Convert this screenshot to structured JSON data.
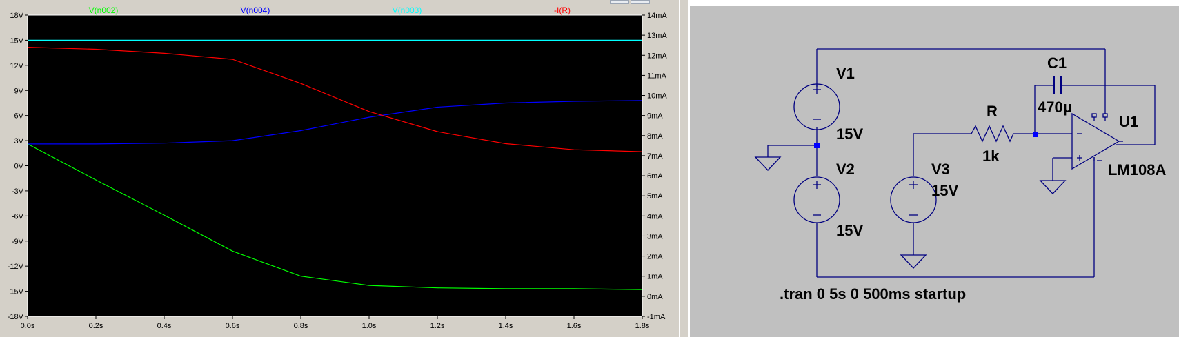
{
  "plot": {
    "traces": [
      {
        "label": "V(n002)",
        "color": "#00ff00",
        "axis": "left",
        "x": [
          0,
          0.2,
          0.4,
          0.6,
          0.8,
          1.0,
          1.2,
          1.4,
          1.6,
          1.8
        ],
        "y": [
          2.6,
          -1.7,
          -5.9,
          -10.2,
          -13.2,
          -14.3,
          -14.6,
          -14.7,
          -14.7,
          -14.8
        ]
      },
      {
        "label": "V(n004)",
        "color": "#0000ff",
        "axis": "left",
        "x": [
          0,
          0.2,
          0.4,
          0.6,
          0.8,
          1.0,
          1.2,
          1.4,
          1.6,
          1.8
        ],
        "y": [
          2.6,
          2.6,
          2.7,
          3.0,
          4.2,
          5.8,
          7.0,
          7.5,
          7.7,
          7.8
        ]
      },
      {
        "label": "V(n003)",
        "color": "#00ffff",
        "axis": "left",
        "x": [
          0,
          1.8
        ],
        "y": [
          15.0,
          15.0
        ]
      },
      {
        "label": "-I(R)",
        "color": "#ff0000",
        "axis": "right",
        "x": [
          0,
          0.2,
          0.4,
          0.6,
          0.8,
          1.0,
          1.2,
          1.4,
          1.6,
          1.8
        ],
        "y": [
          12.4,
          12.3,
          12.1,
          11.8,
          10.6,
          9.2,
          8.2,
          7.6,
          7.3,
          7.2
        ]
      }
    ],
    "left_axis": {
      "ticks": [
        "18V",
        "15V",
        "12V",
        "9V",
        "6V",
        "3V",
        "0V",
        "-3V",
        "-6V",
        "-9V",
        "-12V",
        "-15V",
        "-18V"
      ],
      "ylim": [
        -18,
        18
      ]
    },
    "right_axis": {
      "ticks": [
        "14mA",
        "13mA",
        "12mA",
        "11mA",
        "10mA",
        "9mA",
        "8mA",
        "7mA",
        "6mA",
        "5mA",
        "4mA",
        "3mA",
        "2mA",
        "1mA",
        "0mA",
        "-1mA"
      ],
      "ylim": [
        -1,
        14
      ]
    },
    "x_axis": {
      "ticks": [
        "0.0s",
        "0.2s",
        "0.4s",
        "0.6s",
        "0.8s",
        "1.0s",
        "1.2s",
        "1.4s",
        "1.6s",
        "1.8s"
      ],
      "xlim": [
        0,
        1.8
      ]
    }
  },
  "schematic": {
    "V1": {
      "name": "V1",
      "value": "15V"
    },
    "V2": {
      "name": "V2",
      "value": "15V"
    },
    "V3": {
      "name": "V3",
      "value": "15V"
    },
    "R": {
      "name": "R",
      "value": "1k"
    },
    "C1": {
      "name": "C1",
      "value": "470μ"
    },
    "U1": {
      "name": "U1",
      "value": "LM108A"
    },
    "directive": ".tran 0 5s 0 500ms startup",
    "wire_color": "#000080",
    "background": "#c0c0c0"
  }
}
